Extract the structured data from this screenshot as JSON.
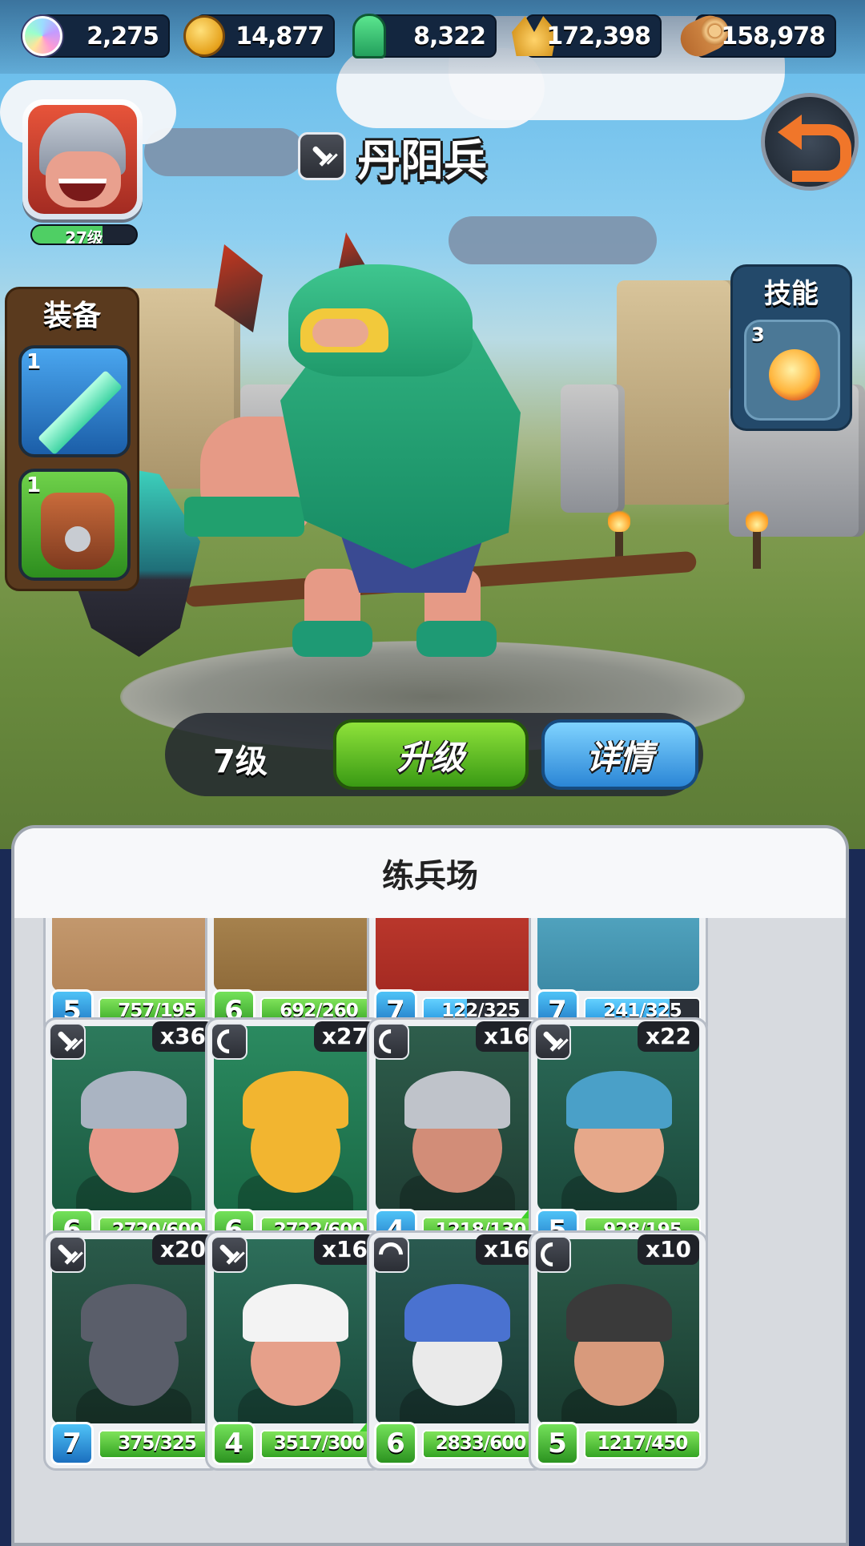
{
  "resources": [
    {
      "icon": "gem-icon",
      "value": "2,275"
    },
    {
      "icon": "gold-coin-icon",
      "value": "14,877"
    },
    {
      "icon": "tombstone-icon",
      "value": "8,322"
    },
    {
      "icon": "wheat-icon",
      "value": "172,398"
    },
    {
      "icon": "wood-log-icon",
      "value": "158,978"
    }
  ],
  "player": {
    "level_label": "27级",
    "xp_progress": 0.68
  },
  "unit": {
    "class_icon": "sword-icon",
    "name": "丹阳兵",
    "level_label": "7级"
  },
  "buttons": {
    "upgrade": "升级",
    "details": "详情"
  },
  "equipment": {
    "title": "装备",
    "items": [
      {
        "icon": "jade-sword-icon",
        "level": "1"
      },
      {
        "icon": "leather-armor-icon",
        "level": "1"
      }
    ]
  },
  "skills": {
    "title": "技能",
    "items": [
      {
        "icon": "fire-skill-icon",
        "level": "3"
      }
    ]
  },
  "training": {
    "title": "练兵场",
    "cards": [
      {
        "level": "5",
        "progress": "757/195",
        "ratio": 1.0,
        "color": "green",
        "count": "",
        "class_icon": ""
      },
      {
        "level": "6",
        "progress": "692/260",
        "ratio": 1.0,
        "color": "green",
        "count": "",
        "class_icon": ""
      },
      {
        "level": "7",
        "progress": "122/325",
        "ratio": 0.38,
        "color": "blue",
        "count": "",
        "class_icon": ""
      },
      {
        "level": "7",
        "progress": "241/325",
        "ratio": 0.74,
        "color": "blue",
        "count": "",
        "class_icon": ""
      },
      {
        "level": "6",
        "progress": "2720/600",
        "ratio": 1.0,
        "color": "green",
        "count": "x36",
        "class_icon": "sword-icon",
        "upgrade": false
      },
      {
        "level": "6",
        "progress": "2722/600",
        "ratio": 1.0,
        "color": "green",
        "count": "x27",
        "class_icon": "bow-icon",
        "upgrade": false
      },
      {
        "level": "4",
        "progress": "1218/130",
        "ratio": 1.0,
        "color": "green",
        "count": "x16",
        "class_icon": "bow-icon",
        "upgrade": true
      },
      {
        "level": "5",
        "progress": "928/195",
        "ratio": 1.0,
        "color": "green",
        "count": "x22",
        "class_icon": "sword-icon",
        "upgrade": false
      },
      {
        "level": "7",
        "progress": "375/325",
        "ratio": 1.0,
        "color": "green",
        "count": "x20",
        "class_icon": "sword-icon",
        "upgrade": false
      },
      {
        "level": "4",
        "progress": "3517/300",
        "ratio": 1.0,
        "color": "green",
        "count": "x16",
        "class_icon": "sword-icon",
        "upgrade": true
      },
      {
        "level": "6",
        "progress": "2833/600",
        "ratio": 1.0,
        "color": "green",
        "count": "x16",
        "class_icon": "mage-icon",
        "upgrade": false
      },
      {
        "level": "5",
        "progress": "1217/450",
        "ratio": 1.0,
        "color": "green",
        "count": "x10",
        "class_icon": "bow-icon",
        "upgrade": false
      }
    ]
  }
}
